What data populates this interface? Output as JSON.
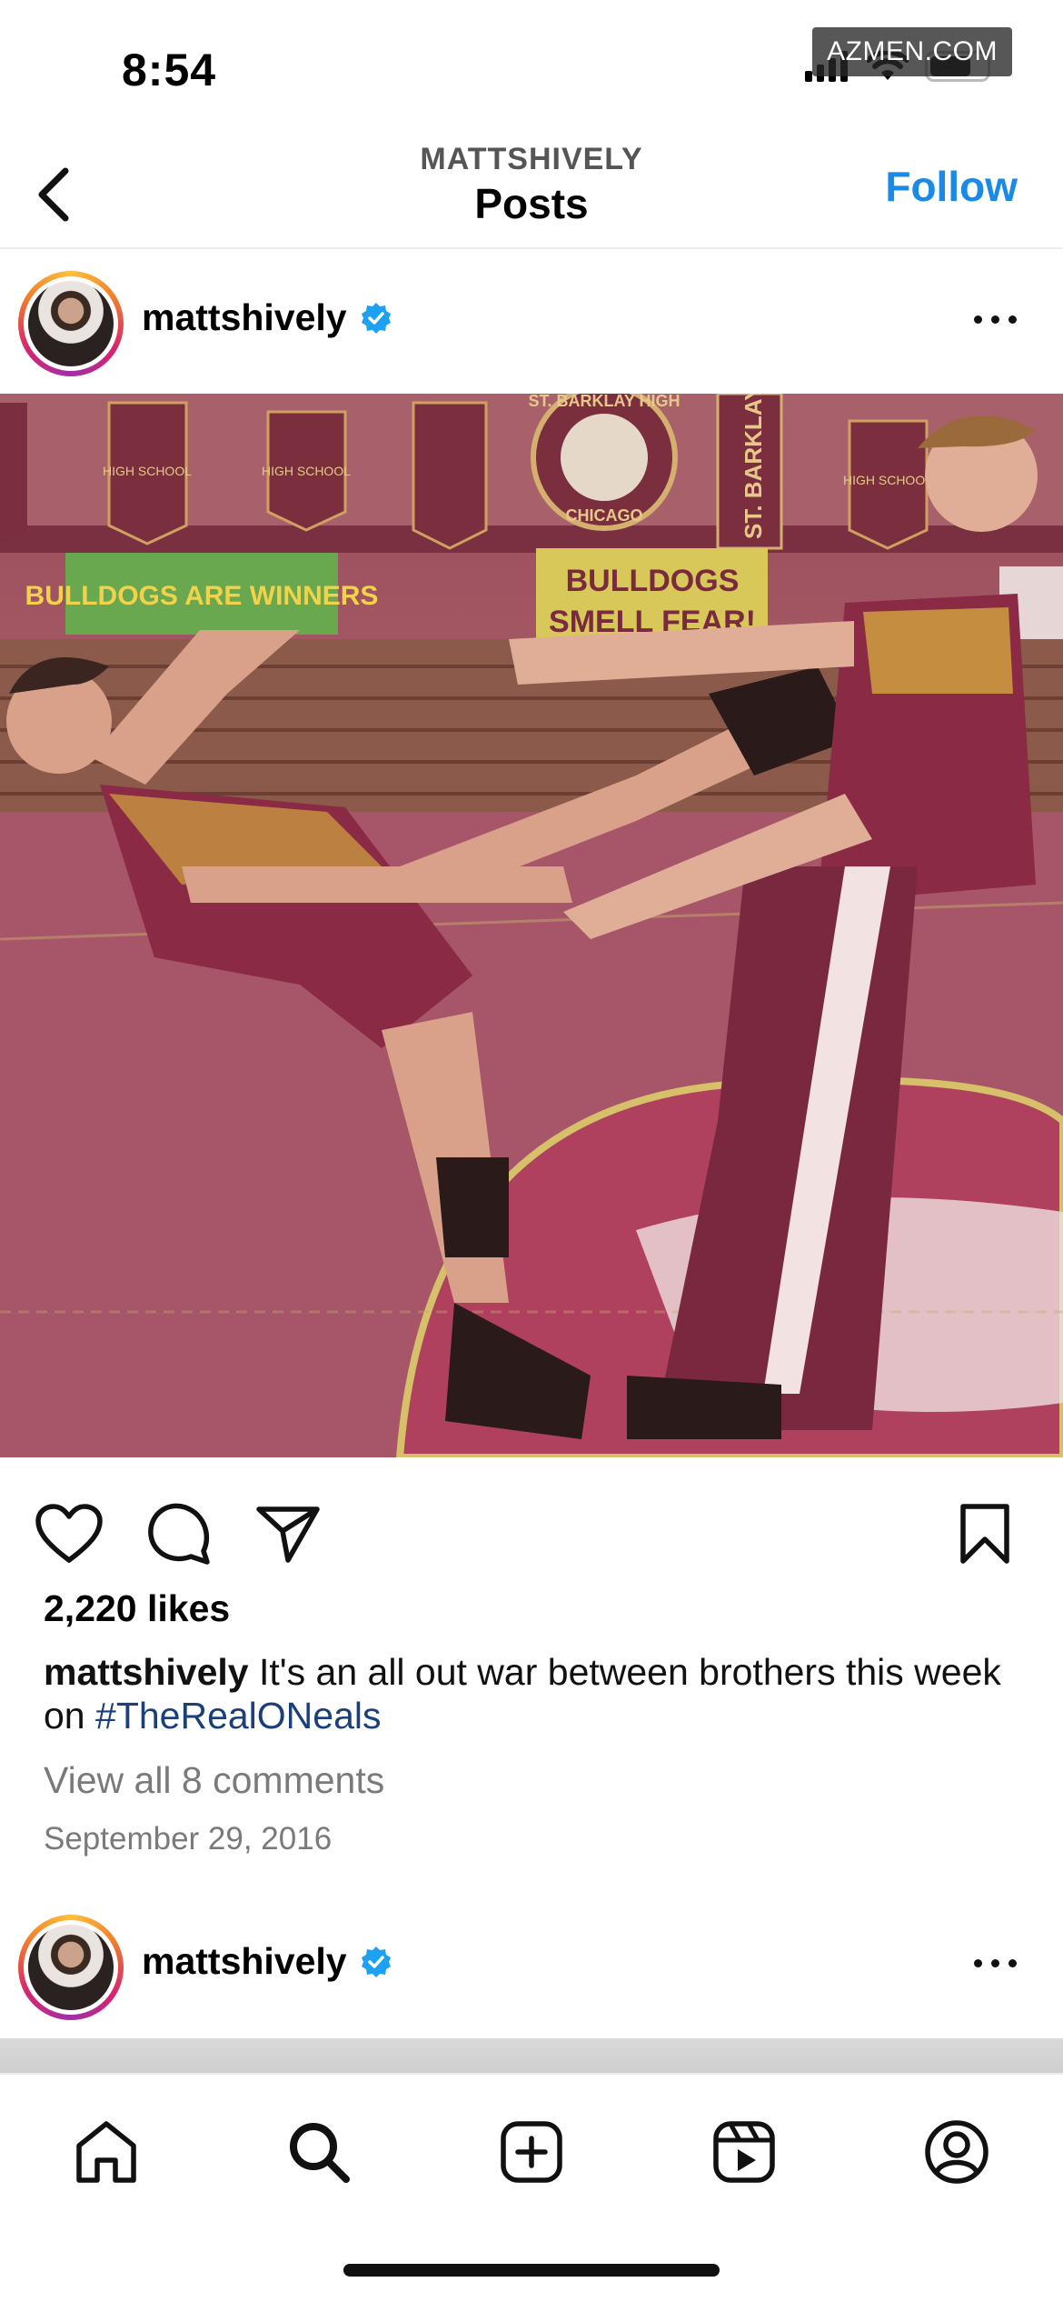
{
  "status_bar": {
    "time": "8:54",
    "watermark": "AZMEN.COM"
  },
  "header": {
    "subtitle": "MATTSHIVELY",
    "title": "Posts",
    "follow_label": "Follow"
  },
  "posts": [
    {
      "username": "mattshively",
      "verified": true,
      "likes": "2,220 likes",
      "caption_user": "mattshively",
      "caption_text": "It's an all out war between brothers this week on",
      "hashtag": "#TheRealONeals",
      "comments_label": "View all 8 comments",
      "date": "September 29, 2016",
      "image_signs": {
        "banner_left": "BULLDOGS ARE WINNERS",
        "banner_center_1": "BULLDOGS",
        "banner_center_2": "SMELL FEAR!",
        "seal_top": "ST. BARKLAY HIGH",
        "seal_bottom": "CHICAGO",
        "right_sign": "ST. BARKLAY",
        "pennant_1": "HIGH SCHOOL",
        "pennant_2": "HIGH SCHOOL",
        "pennant_3": "HIGH SCHOOL"
      }
    },
    {
      "username": "mattshively",
      "verified": true
    }
  ],
  "colors": {
    "accent": "#1a8ae6",
    "hashtag": "#1b3f7a",
    "muted": "#7a7a7a",
    "verified": "#1da1f2"
  },
  "icons": {
    "back": "chevron-left-icon",
    "like": "heart-icon",
    "comment": "comment-bubble-icon",
    "share": "paper-plane-icon",
    "save": "bookmark-icon",
    "home": "home-icon",
    "search": "search-icon",
    "create": "plus-square-icon",
    "reels": "reels-icon",
    "profile": "profile-icon"
  }
}
